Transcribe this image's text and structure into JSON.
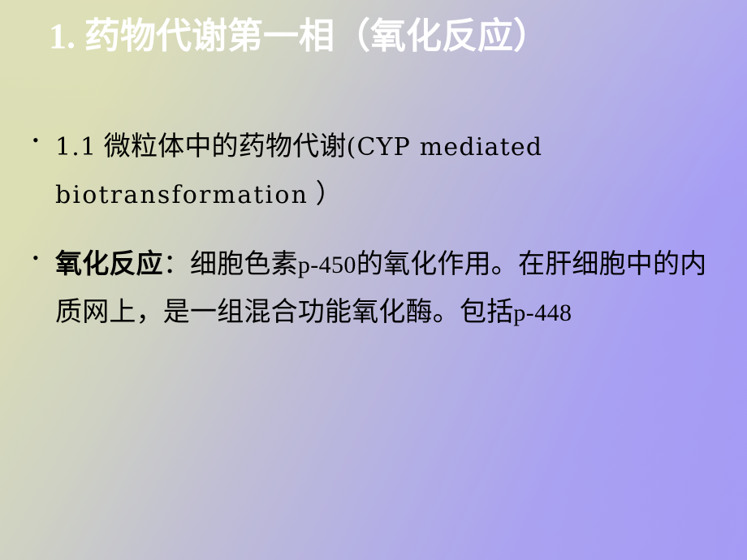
{
  "slide": {
    "background": {
      "gradient_from": "#dcdeb4",
      "gradient_to": "#a296f8",
      "direction": "top-left to bottom-right"
    },
    "title": {
      "text": "1. 药物代谢第一相（氧化反应）",
      "color": "#ffffff"
    },
    "body": {
      "text_color": "#000000",
      "bullet_glyph": "•",
      "items": [
        {
          "id": "bullet-1",
          "bullet": "•",
          "segments": [
            {
              "kind": "latin",
              "text": "1.1",
              "bold": false
            },
            {
              "kind": "han",
              "text": "  微粒体中的药物代谢",
              "bold": false
            },
            {
              "kind": "latin_paren",
              "text": "(CYP  mediated",
              "bold": false
            },
            {
              "kind": "linebreak",
              "text": ""
            },
            {
              "kind": "latin_wide",
              "text": "biotransformation",
              "bold": false
            },
            {
              "kind": "han",
              "text": " ）",
              "bold": false
            }
          ],
          "plain_text": "1.1  微粒体中的药物代谢(CYP mediated biotransformation ）"
        },
        {
          "id": "bullet-2",
          "bullet": "•",
          "segments": [
            {
              "kind": "han",
              "text": "氧化反应",
              "bold": true
            },
            {
              "kind": "han",
              "text": "：细胞色素",
              "bold": false
            },
            {
              "kind": "latin_tight",
              "text": "p-450",
              "bold": false
            },
            {
              "kind": "han",
              "text": "的氧化作用。在肝细胞中的内质网上，是一组混合功能氧化酶。包括",
              "bold": false
            },
            {
              "kind": "latin_tight",
              "text": "p-448",
              "bold": false
            }
          ],
          "plain_text": "氧化反应：细胞色素p-450的氧化作用。在肝细胞中的内质网上，是一组混合功能氧化酶。包括p-448"
        }
      ]
    }
  }
}
